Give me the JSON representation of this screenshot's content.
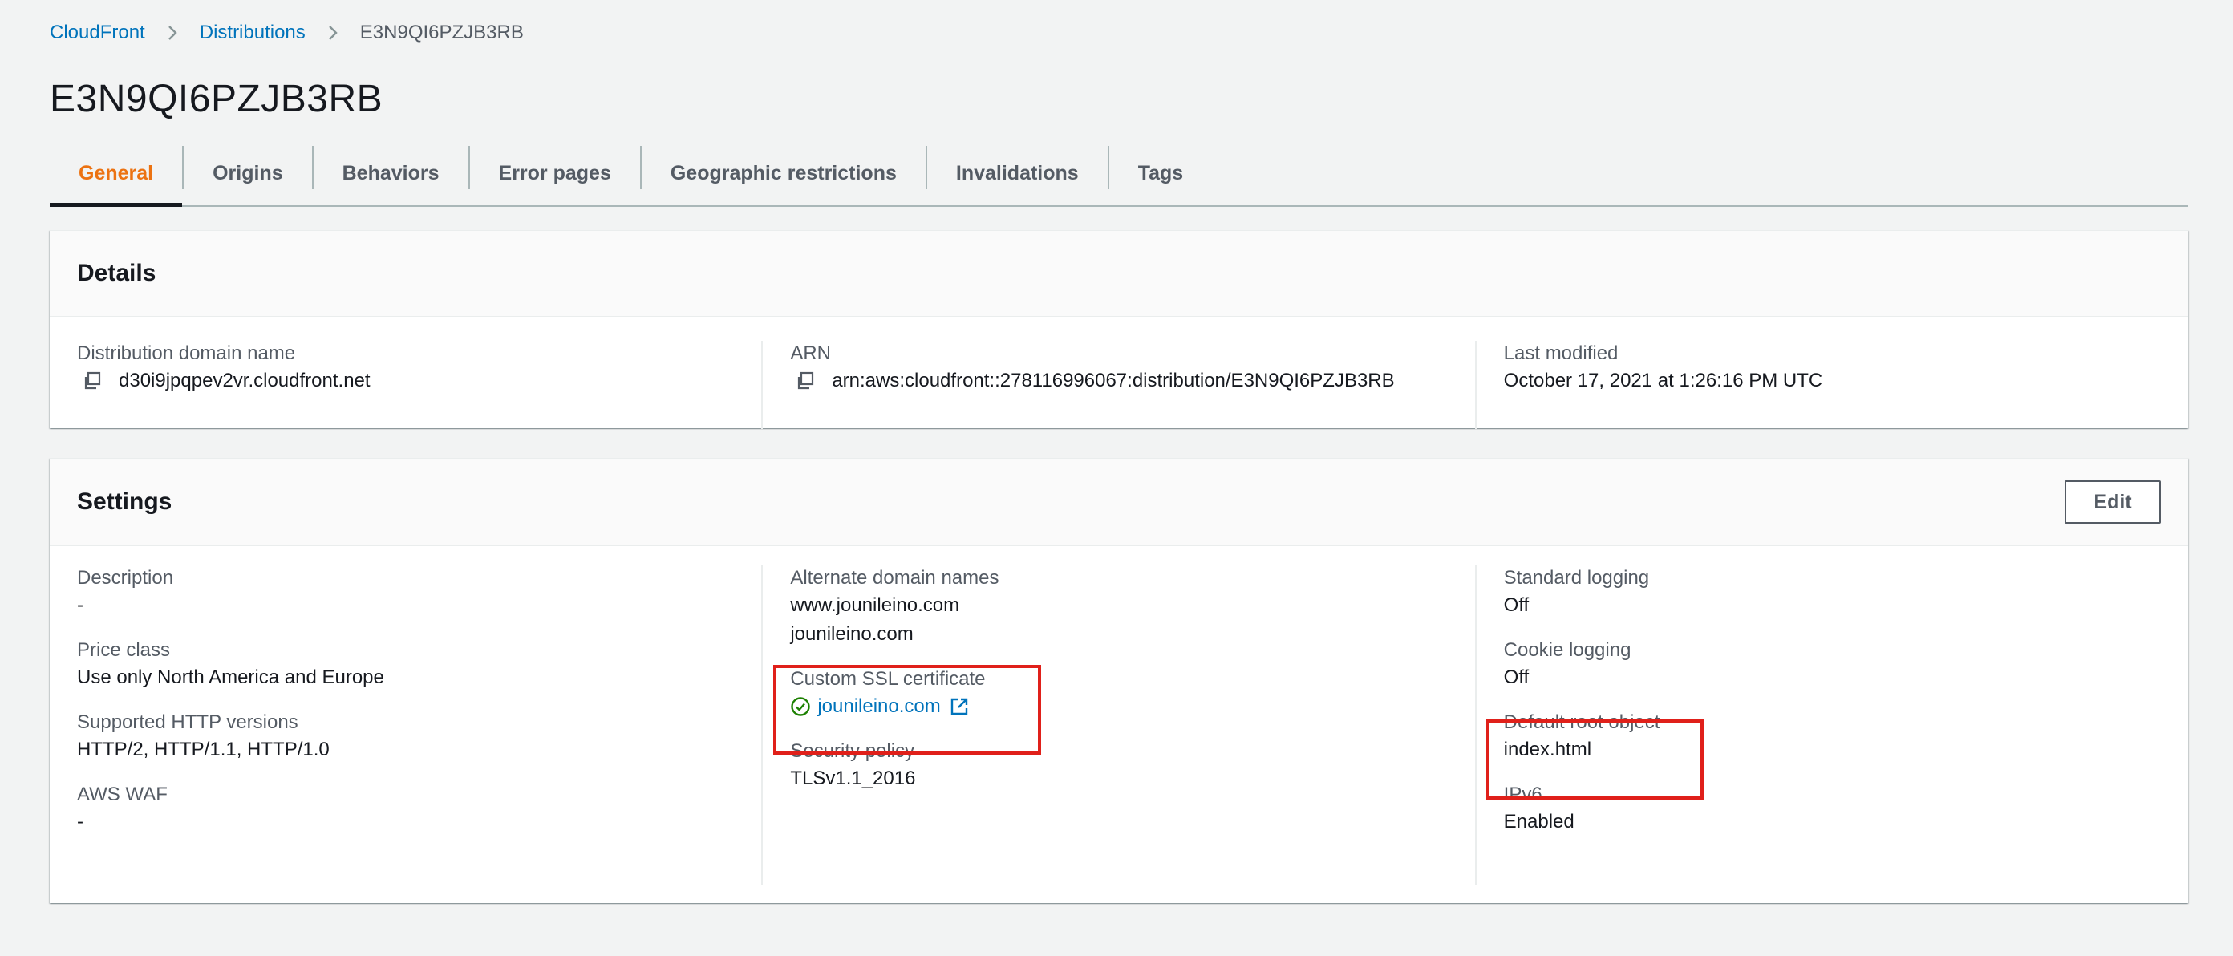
{
  "breadcrumb": {
    "items": [
      "CloudFront",
      "Distributions"
    ],
    "current": "E3N9QI6PZJB3RB"
  },
  "page": {
    "title": "E3N9QI6PZJB3RB"
  },
  "tabs": [
    {
      "label": "General",
      "active": true
    },
    {
      "label": "Origins"
    },
    {
      "label": "Behaviors"
    },
    {
      "label": "Error pages"
    },
    {
      "label": "Geographic restrictions"
    },
    {
      "label": "Invalidations"
    },
    {
      "label": "Tags"
    }
  ],
  "details": {
    "title": "Details",
    "domain_label": "Distribution domain name",
    "domain_value": "d30i9jpqpev2vr.cloudfront.net",
    "arn_label": "ARN",
    "arn_value": "arn:aws:cloudfront::278116996067:distribution/E3N9QI6PZJB3RB",
    "modified_label": "Last modified",
    "modified_value": "October 17, 2021 at 1:26:16 PM UTC"
  },
  "settings": {
    "title": "Settings",
    "edit_label": "Edit",
    "description_label": "Description",
    "description_value": "-",
    "price_label": "Price class",
    "price_value": "Use only North America and Europe",
    "http_label": "Supported HTTP versions",
    "http_value": "HTTP/2, HTTP/1.1, HTTP/1.0",
    "waf_label": "AWS WAF",
    "waf_value": "-",
    "alt_label": "Alternate domain names",
    "alt_values": [
      "www.jounileino.com",
      "jounileino.com"
    ],
    "ssl_label": "Custom SSL certificate",
    "ssl_value": "jounileino.com",
    "security_label": "Security policy",
    "security_value": "TLSv1.1_2016",
    "std_logging_label": "Standard logging",
    "std_logging_value": "Off",
    "cookie_label": "Cookie logging",
    "cookie_value": "Off",
    "root_label": "Default root object",
    "root_value": "index.html",
    "ipv6_label": "IPv6",
    "ipv6_value": "Enabled"
  },
  "colors": {
    "accent": "#ec7211",
    "link": "#0073bb",
    "success": "#1d8102",
    "highlight": "#e0201a"
  }
}
